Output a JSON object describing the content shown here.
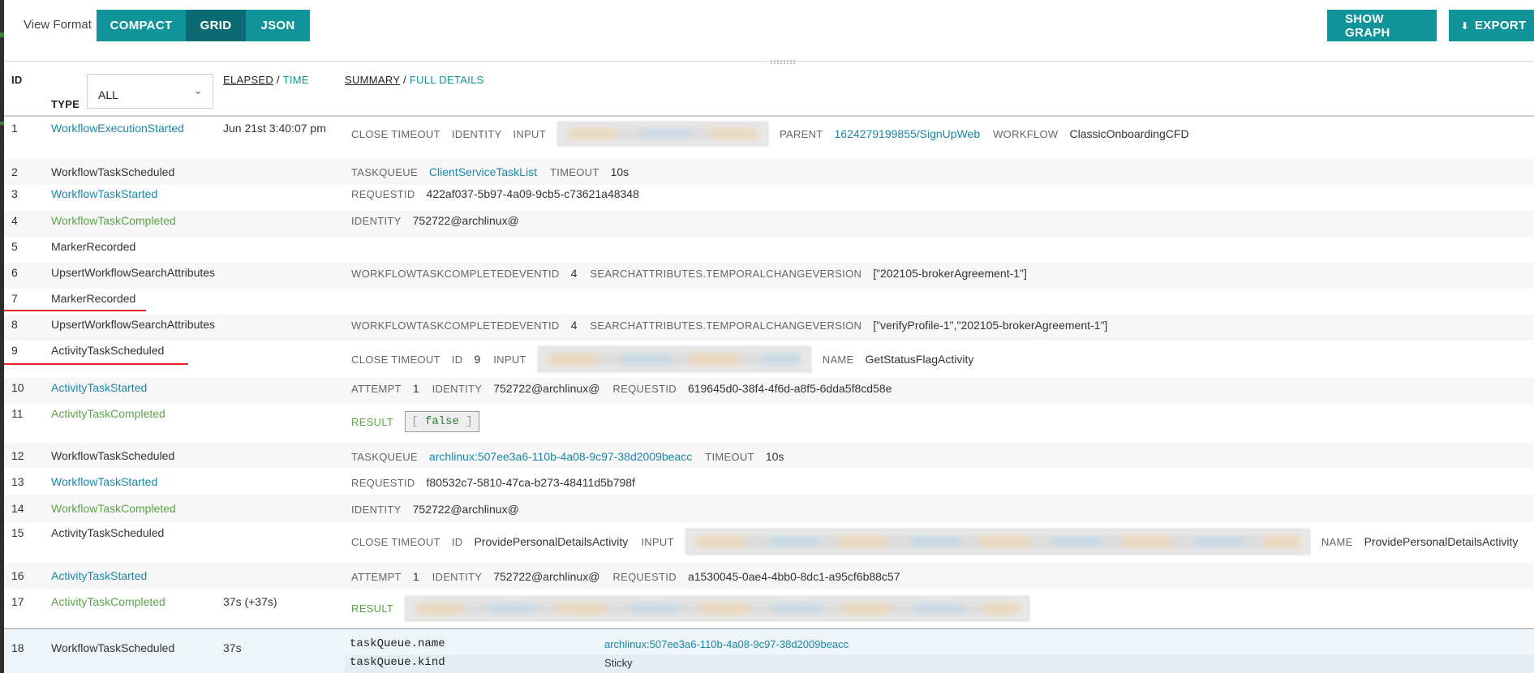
{
  "toolbar": {
    "view_format_label": "View Format",
    "formats": [
      "COMPACT",
      "GRID",
      "JSON"
    ],
    "active_format": "GRID",
    "show_graph": "SHOW GRAPH",
    "export": "EXPORT",
    "export_icon": "download-icon"
  },
  "header": {
    "id": "ID",
    "type": "TYPE",
    "type_filter": "ALL",
    "elapsed": "ELAPSED",
    "time": "TIME",
    "summary": "SUMMARY",
    "full_details": "FULL DETAILS",
    "slash": "/"
  },
  "events": [
    {
      "id": "1",
      "type": "WorkflowExecutionStarted",
      "time": "Jun 21st 3:40:07 pm",
      "close_timeout": "CLOSE TIMEOUT",
      "identity": "IDENTITY",
      "input": "INPUT",
      "parent_key": "PARENT",
      "parent_val": "1624279199855/SignUpWeb",
      "workflow_key": "WORKFLOW",
      "workflow_val": "ClassicOnboardingCFD"
    },
    {
      "id": "2",
      "type": "WorkflowTaskScheduled",
      "taskqueue_key": "TASKQUEUE",
      "taskqueue_val": "ClientServiceTaskList",
      "timeout_key": "TIMEOUT",
      "timeout_val": "10s"
    },
    {
      "id": "3",
      "type": "WorkflowTaskStarted",
      "requestid_key": "REQUESTID",
      "requestid_val": "422af037-5b97-4a09-9cb5-c73621a48348"
    },
    {
      "id": "4",
      "type": "WorkflowTaskCompleted",
      "identity_key": "IDENTITY",
      "identity_val": "752722@archlinux@"
    },
    {
      "id": "5",
      "type": "MarkerRecorded"
    },
    {
      "id": "6",
      "type": "UpsertWorkflowSearchAttributes",
      "k1": "WORKFLOWTASKCOMPLETEDEVENTID",
      "v1": "4",
      "k2": "SEARCHATTRIBUTES.TEMPORALCHANGEVERSION",
      "v2": "[\"202105-brokerAgreement-1\"]"
    },
    {
      "id": "7",
      "type": "MarkerRecorded"
    },
    {
      "id": "8",
      "type": "UpsertWorkflowSearchAttributes",
      "k1": "WORKFLOWTASKCOMPLETEDEVENTID",
      "v1": "4",
      "k2": "SEARCHATTRIBUTES.TEMPORALCHANGEVERSION",
      "v2": "[\"verifyProfile-1\",\"202105-brokerAgreement-1\"]"
    },
    {
      "id": "9",
      "type": "ActivityTaskScheduled",
      "close_timeout": "CLOSE TIMEOUT",
      "id_key": "ID",
      "id_val": "9",
      "input": "INPUT",
      "name_key": "NAME",
      "name_val": "GetStatusFlagActivity"
    },
    {
      "id": "10",
      "type": "ActivityTaskStarted",
      "attempt_key": "ATTEMPT",
      "attempt_val": "1",
      "identity_key": "IDENTITY",
      "identity_val": "752722@archlinux@",
      "requestid_key": "REQUESTID",
      "requestid_val": "619645d0-38f4-4f6d-a8f5-6dda5f8cd58e"
    },
    {
      "id": "11",
      "type": "ActivityTaskCompleted",
      "result_key": "RESULT",
      "result_open": "[",
      "result_val": "false",
      "result_close": "]"
    },
    {
      "id": "12",
      "type": "WorkflowTaskScheduled",
      "taskqueue_key": "TASKQUEUE",
      "taskqueue_val": "archlinux:507ee3a6-110b-4a08-9c97-38d2009beacc",
      "timeout_key": "TIMEOUT",
      "timeout_val": "10s"
    },
    {
      "id": "13",
      "type": "WorkflowTaskStarted",
      "requestid_key": "REQUESTID",
      "requestid_val": "f80532c7-5810-47ca-b273-48411d5b798f"
    },
    {
      "id": "14",
      "type": "WorkflowTaskCompleted",
      "identity_key": "IDENTITY",
      "identity_val": "752722@archlinux@"
    },
    {
      "id": "15",
      "type": "ActivityTaskScheduled",
      "close_timeout": "CLOSE TIMEOUT",
      "id_key": "ID",
      "id_val": "ProvidePersonalDetailsActivity",
      "input": "INPUT",
      "name_key": "NAME",
      "name_val": "ProvidePersonalDetailsActivity"
    },
    {
      "id": "16",
      "type": "ActivityTaskStarted",
      "attempt_key": "ATTEMPT",
      "attempt_val": "1",
      "identity_key": "IDENTITY",
      "identity_val": "752722@archlinux@",
      "requestid_key": "REQUESTID",
      "requestid_val": "a1530045-0ae4-4bb0-8dc1-a95cf6b88c57"
    },
    {
      "id": "17",
      "type": "ActivityTaskCompleted",
      "time": "37s (+37s)",
      "result_key": "RESULT"
    },
    {
      "id": "18",
      "type": "WorkflowTaskScheduled",
      "time": "37s",
      "details": [
        {
          "key": "taskQueue.name",
          "value": "archlinux:507ee3a6-110b-4a08-9c97-38d2009beacc"
        },
        {
          "key": "taskQueue.kind",
          "value": "Sticky"
        }
      ]
    }
  ],
  "colors": {
    "teal": "#11939a",
    "teal_active": "#0b6a72",
    "link": "#1a87a8",
    "completed": "#5da24b",
    "annotation": "#e52222"
  }
}
